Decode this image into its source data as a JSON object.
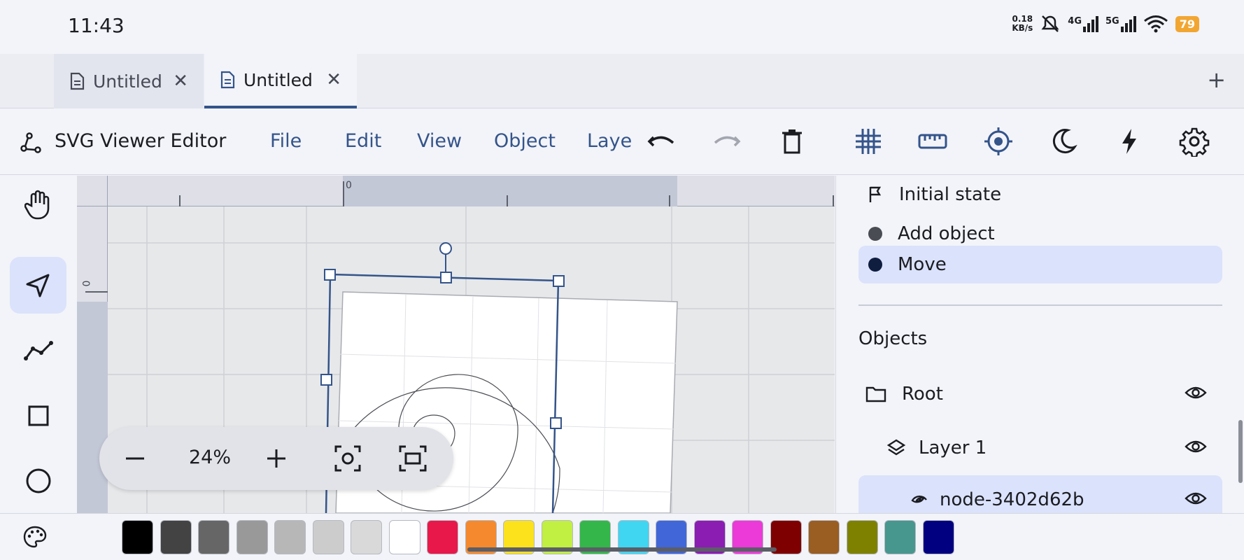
{
  "status": {
    "time": "11:43",
    "net_speed_value": "0.18",
    "net_speed_unit": "KB/s",
    "network_4g": "4G",
    "network_5g": "5G",
    "battery": "79"
  },
  "tabs": [
    {
      "label": "Untitled",
      "icon": "document-icon",
      "active": false
    },
    {
      "label": "Untitled",
      "icon": "document-icon",
      "active": true
    }
  ],
  "toolbar": {
    "title": "SVG Viewer Editor",
    "menus": [
      "File",
      "Edit",
      "View",
      "Object",
      "Laye"
    ],
    "icons": [
      "undo-icon",
      "redo-icon",
      "delete-icon",
      "grid-icon",
      "ruler-icon",
      "snap-target-icon",
      "dark-mode-icon",
      "flash-icon",
      "settings-icon"
    ]
  },
  "tools": [
    "hand-icon",
    "select-arrow-icon",
    "polyline-icon",
    "rectangle-icon",
    "circle-icon"
  ],
  "canvas": {
    "ruler_top_zero": "0",
    "ruler_left_zero": "0"
  },
  "zoom": {
    "value": "24%"
  },
  "history": [
    {
      "label": "Initial state",
      "icon": "flag-icon"
    },
    {
      "label": "Add object",
      "icon": "dot-icon"
    },
    {
      "label": "Move",
      "icon": "dot-icon",
      "active": true
    }
  ],
  "objects": {
    "title": "Objects",
    "items": [
      {
        "label": "Root",
        "icon": "folder-icon"
      },
      {
        "label": "Layer 1",
        "icon": "layers-icon"
      },
      {
        "label": "node-3402d62b",
        "icon": "spiral-icon",
        "active": true
      }
    ]
  },
  "palette": {
    "colors": [
      "#000000",
      "#434343",
      "#666666",
      "#999999",
      "#b7b7b7",
      "#cccccc",
      "#d9d9d9",
      "#ffffff",
      "#e8184a",
      "#f5892d",
      "#fbe21c",
      "#c1ef42",
      "#34b64a",
      "#40d6f2",
      "#4166d8",
      "#8b1db3",
      "#ec3ad9",
      "#7f0000",
      "#9a5d22",
      "#7e8100",
      "#47978f",
      "#000080"
    ]
  },
  "colors": {
    "accent": "#34548a",
    "active_bg": "#dbe2fb"
  }
}
